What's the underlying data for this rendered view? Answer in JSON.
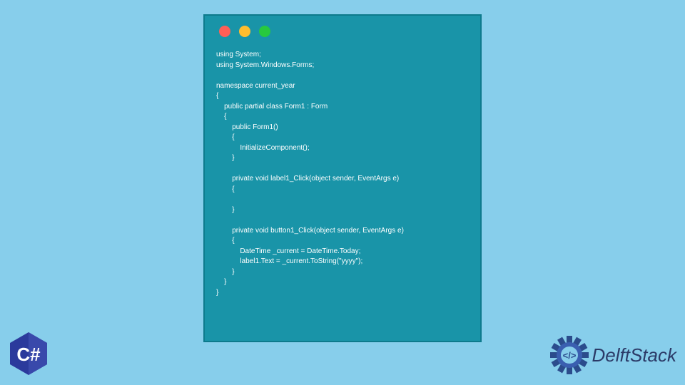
{
  "window": {
    "dot1": "red",
    "dot2": "yellow",
    "dot3": "green"
  },
  "code": "using System;\nusing System.Windows.Forms;\n\nnamespace current_year\n{\n    public partial class Form1 : Form\n    {\n        public Form1()\n        {\n            InitializeComponent();\n        }\n\n        private void label1_Click(object sender, EventArgs e)\n        {\n\n        }\n\n        private void button1_Click(object sender, EventArgs e)\n        {\n            DateTime _current = DateTime.Today;\n            label1.Text = _current.ToString(\"yyyy\");\n        }\n    }\n}",
  "badge": {
    "text": "C#"
  },
  "brand": {
    "name": "DelftStack"
  }
}
